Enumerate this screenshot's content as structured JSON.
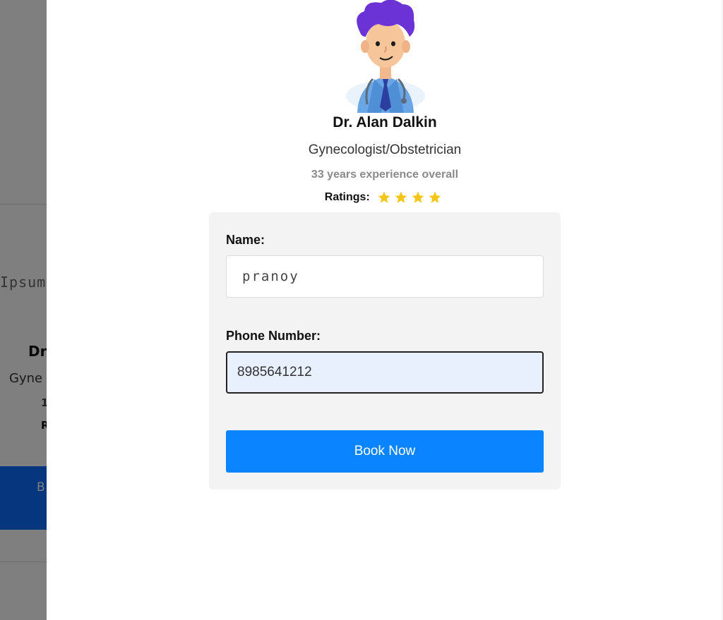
{
  "background": {
    "lorem_fragment": "Ipsum",
    "doctor_name_fragment": "Dr",
    "specialty_fragment": "Gyne",
    "experience_fragment": "1",
    "ratings_fragment": "R",
    "button_fragment": "B"
  },
  "doctor": {
    "avatar_icon": "doctor-avatar-icon",
    "name": "Dr. Alan Dalkin",
    "specialty": "Gynecologist/Obstetrician",
    "experience": "33 years experience overall",
    "ratings_label": "Ratings:",
    "rating": 4,
    "star_icon": "star-icon",
    "star_color": "#f5c518"
  },
  "form": {
    "name_label": "Name:",
    "name_value": "pranoy",
    "phone_label": "Phone Number:",
    "phone_value": "8985641212",
    "submit_label": "Book Now"
  },
  "colors": {
    "accent": "#0a84ff",
    "card_background": "#f3f3f4",
    "phone_input_background": "#e8f0fe",
    "backdrop": "rgba(0,0,0,0.5)"
  }
}
